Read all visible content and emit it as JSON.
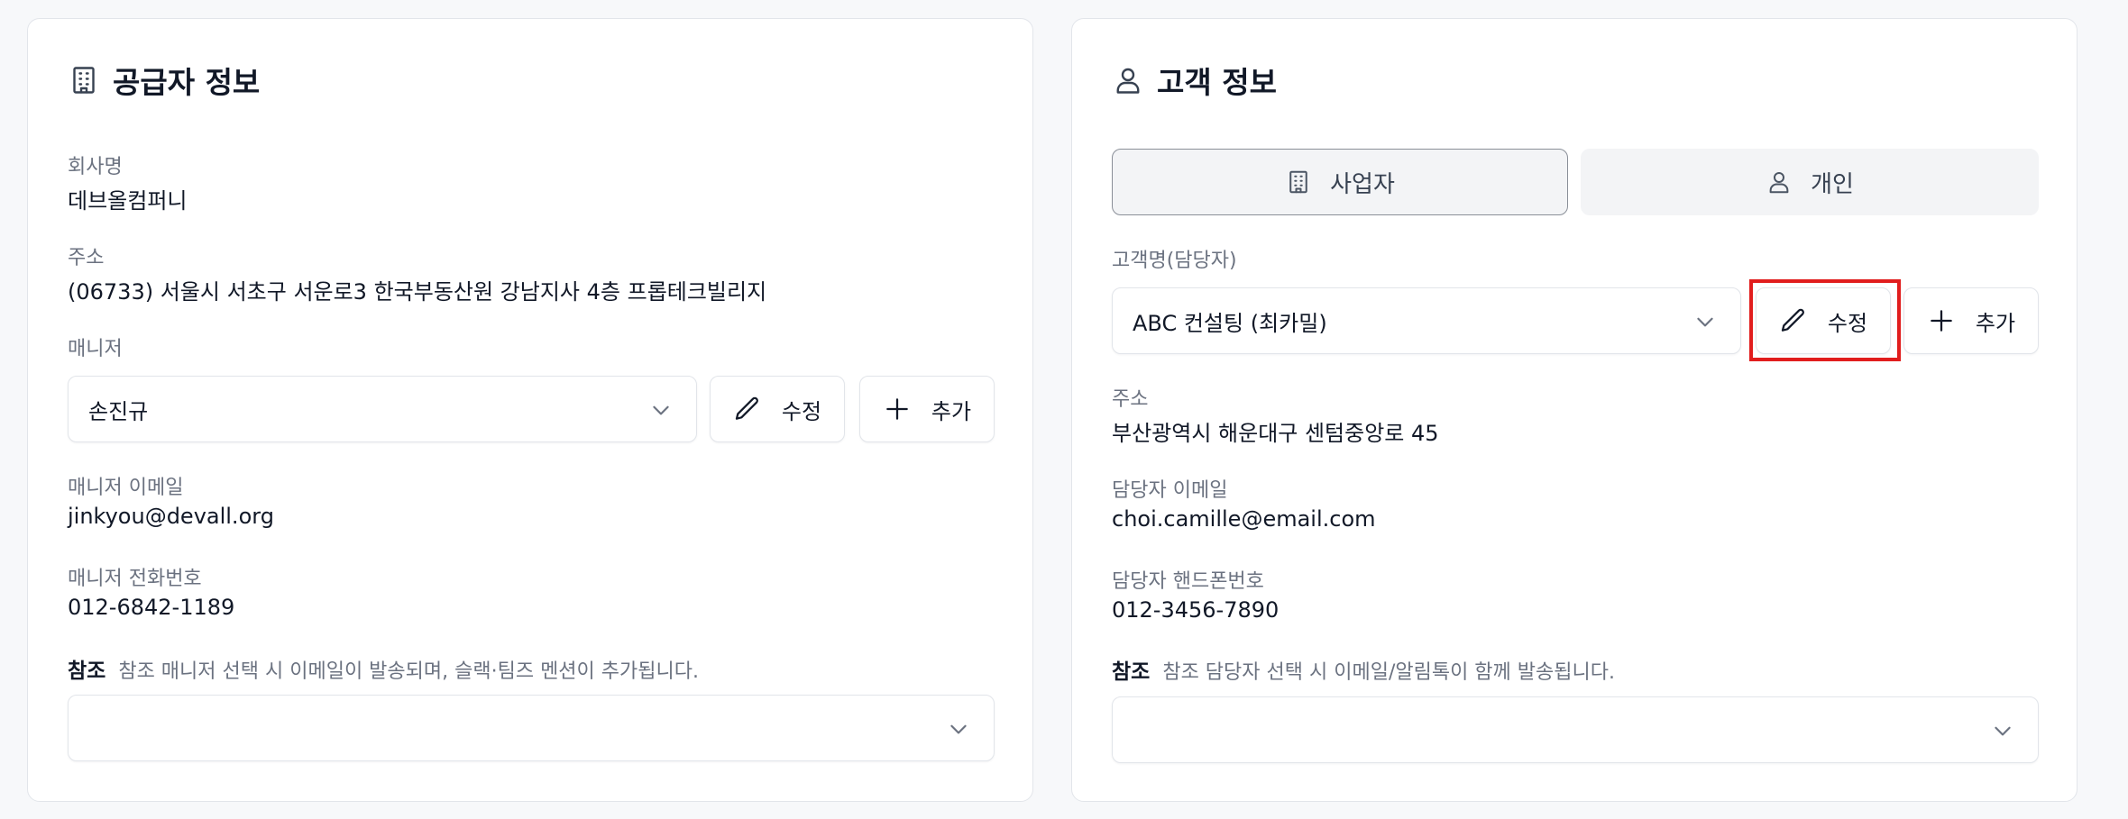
{
  "supplier": {
    "title": "공급자 정보",
    "company_label": "회사명",
    "company_value": "데브올컴퍼니",
    "address_label": "주소",
    "address_value": "(06733) 서울시 서초구 서운로3 한국부동산원 강남지사 4층 프롭테크빌리지",
    "manager_label": "매니저",
    "manager_selected": "손진규",
    "edit_label": "수정",
    "add_label": "추가",
    "manager_email_label": "매니저 이메일",
    "manager_email_value": "jinkyou@devall.org",
    "manager_phone_label": "매니저 전화번호",
    "manager_phone_value": "012-6842-1189",
    "ref_label": "참조",
    "ref_desc": "참조 매니저 선택 시 이메일이 발송되며, 슬랙·팀즈 멘션이 추가됩니다.",
    "ref_selected": ""
  },
  "customer": {
    "title": "고객 정보",
    "type_business": "사업자",
    "type_individual": "개인",
    "selected_type": "사업자",
    "name_label": "고객명(담당자)",
    "name_selected": "ABC 컨설팅 (최카밀)",
    "edit_label": "수정",
    "add_label": "추가",
    "address_label": "주소",
    "address_value": "부산광역시 해운대구 센텀중앙로 45",
    "email_label": "담당자 이메일",
    "email_value": "choi.camille@email.com",
    "phone_label": "담당자 핸드폰번호",
    "phone_value": "012-3456-7890",
    "ref_label": "참조",
    "ref_desc": "참조 담당자 선택 시 이메일/알림톡이 함께 발송됩니다.",
    "ref_selected": ""
  },
  "icons": {
    "supplier_title": "building-icon",
    "customer_title": "user-icon",
    "dropdown": "chevron-down-icon",
    "edit": "pencil-icon",
    "add": "plus-icon"
  },
  "colors": {
    "highlight": "#e11d1d",
    "card_border": "#e2e5ea",
    "muted_text": "#6b7280"
  }
}
